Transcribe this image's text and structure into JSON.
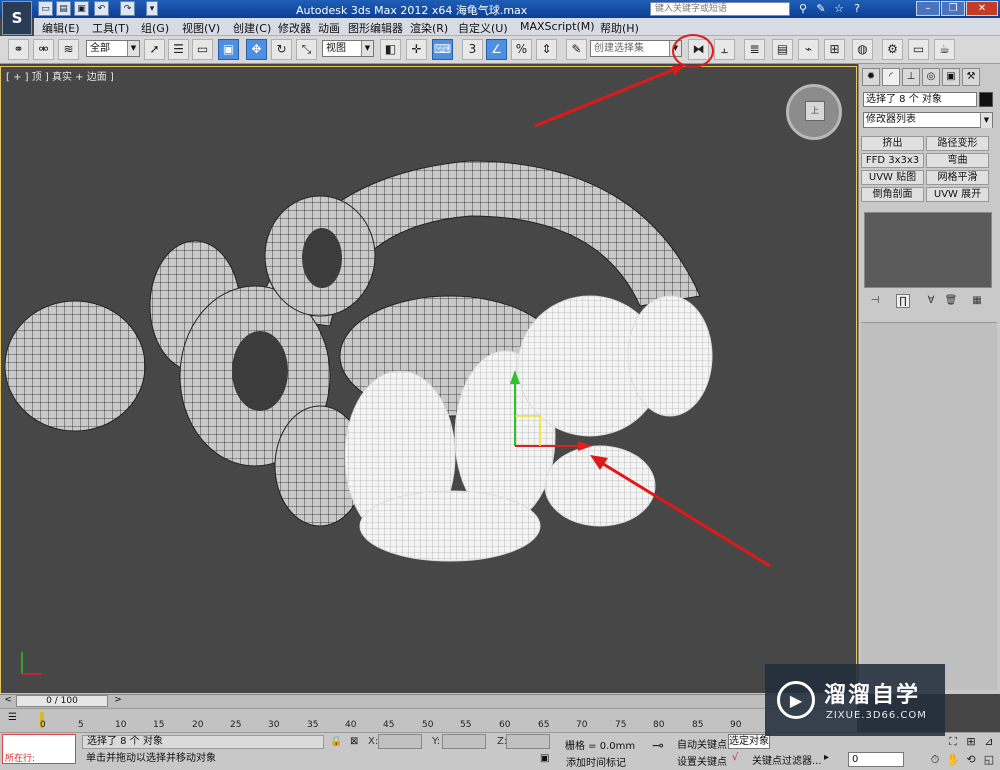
{
  "app": {
    "logo": "S",
    "title": "Autodesk 3ds Max  2012 x64      海龟气球.max",
    "help_search_placeholder": "键入关键字或短语"
  },
  "menubar": {
    "items": [
      "编辑(E)",
      "工具(T)",
      "组(G)",
      "视图(V)",
      "创建(C)",
      "修改器",
      "动画",
      "图形编辑器",
      "渲染(R)",
      "自定义(U)",
      "MAXScript(M)",
      "帮助(H)"
    ]
  },
  "toolbar": {
    "selection_filter": "全部",
    "reference_coord": "视图",
    "named_selection_set": "创建选择集",
    "icons": [
      "link-icon",
      "unlink-icon",
      "bind-space-warp-icon",
      "select-object-icon",
      "select-by-name-icon",
      "rect-region-icon",
      "window-crossing-icon",
      "select-move-icon",
      "select-rotate-icon",
      "select-scale-icon",
      "pivot-center-icon",
      "select-manipulate-icon",
      "keyboard-shortcut-icon",
      "snap-3-icon",
      "angle-snap-icon",
      "percent-snap-icon",
      "spinner-snap-icon",
      "edit-named-sel-icon",
      "mirror-icon",
      "align-icon",
      "layer-manager-icon",
      "graphite-icon",
      "curve-editor-icon",
      "schematic-icon",
      "material-editor-icon",
      "render-setup-icon",
      "render-frame-icon",
      "render-icon"
    ]
  },
  "viewport": {
    "label": "[ + ] 顶 ] 真实 + 边面 ]",
    "viewcube_face": "上"
  },
  "command_panel": {
    "tabs": [
      "create-tab",
      "modify-tab",
      "hierarchy-tab",
      "motion-tab",
      "display-tab",
      "utilities-tab"
    ],
    "selection_text": "选择了 8 个 对象",
    "modifier_list": "修改器列表",
    "modifier_buttons": [
      "挤出",
      "路径变形",
      "FFD 3x3x3",
      "弯曲",
      "UVW 贴图",
      "网格平滑",
      "倒角剖面",
      "UVW 展开"
    ]
  },
  "timeline": {
    "slider_text": "0 / 100",
    "ticks": [
      "0",
      "5",
      "10",
      "15",
      "20",
      "25",
      "30",
      "35",
      "40",
      "45",
      "50",
      "55",
      "60",
      "65",
      "70",
      "75",
      "80",
      "85",
      "90"
    ]
  },
  "status": {
    "maxscript_text": "所在行:",
    "selection": "选择了 8 个 对象",
    "prompt": "单击并拖动以选择并移动对象",
    "x_label": "X:",
    "y_label": "Y:",
    "z_label": "Z:",
    "grid": "栅格 = 0.0mm",
    "add_time_tag": "添加时间标记",
    "auto_key": "自动关键点",
    "set_key": "设置关键点",
    "selected_filter": "选定对象",
    "key_filters": "关键点过滤器...",
    "frame": "0"
  },
  "watermark": {
    "title": "溜溜自学",
    "url": "ZIXUE.3D66.COM"
  }
}
